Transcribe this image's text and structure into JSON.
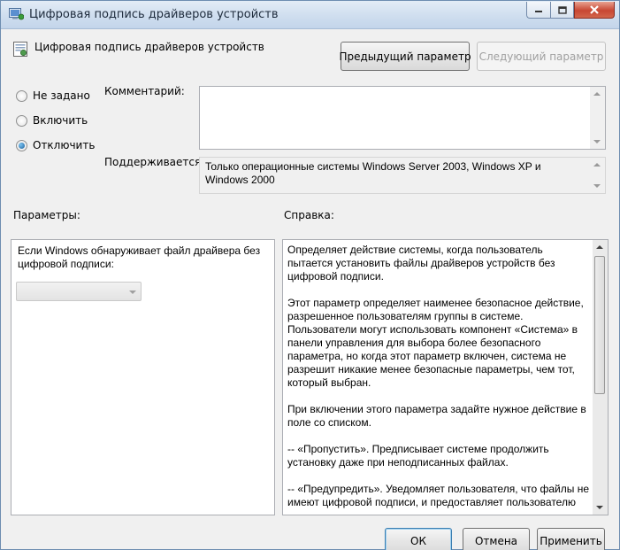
{
  "window": {
    "title": "Цифровая подпись драйверов устройств",
    "controls": {
      "minimize": "minimize",
      "maximize": "maximize",
      "close": "close"
    }
  },
  "header": {
    "policy_name": "Цифровая подпись драйверов устройств",
    "prev_button": "Предыдущий параметр",
    "next_button": "Следующий параметр"
  },
  "state": {
    "options": [
      {
        "label": "Не задано",
        "checked": false
      },
      {
        "label": "Включить",
        "checked": false
      },
      {
        "label": "Отключить",
        "checked": true
      }
    ]
  },
  "comment": {
    "label": "Комментарий:",
    "value": ""
  },
  "supported": {
    "label": "Поддерживается:",
    "value": "Только операционные системы Windows Server 2003, Windows XP и Windows 2000"
  },
  "options_panel": {
    "label": "Параметры:",
    "description": "Если Windows обнаруживает файл драйвера без цифровой подписи:",
    "dropdown_value": ""
  },
  "help_panel": {
    "label": "Справка:",
    "paragraphs": [
      "Определяет действие системы, когда пользователь пытается установить файлы драйверов устройств без цифровой подписи.",
      "Этот параметр определяет наименее безопасное действие, разрешенное пользователям группы в системе. Пользователи могут использовать компонент «Система» в панели управления для выбора более безопасного параметра, но когда этот параметр включен, система не разрешит никакие менее безопасные параметры, чем тот, который выбран.",
      "При включении этого параметра задайте нужное действие в поле со списком.",
      "--   «Пропустить». Предписывает системе продолжить установку даже при неподписанных файлах.",
      "--   «Предупредить». Уведомляет пользователя, что файлы не имеют цифровой подписи, и предоставляет пользователю"
    ]
  },
  "footer": {
    "ok": "ОК",
    "cancel": "Отмена",
    "apply": "Применить"
  }
}
